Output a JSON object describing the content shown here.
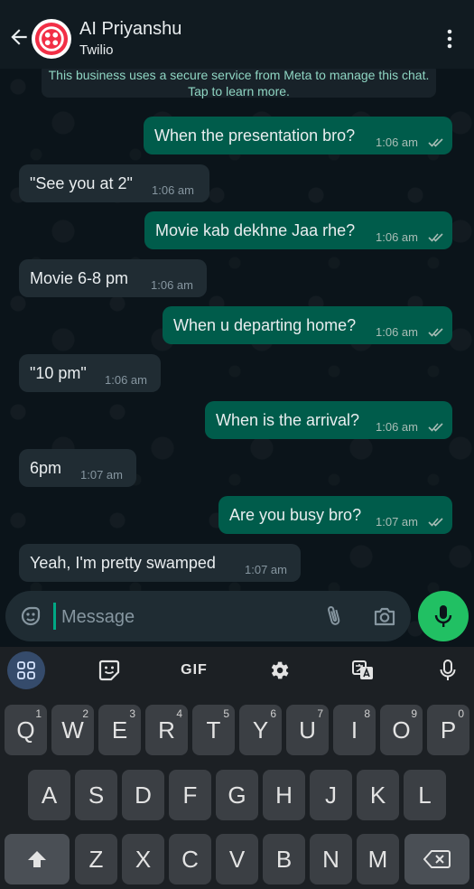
{
  "header": {
    "contact_name": "AI Priyanshu",
    "contact_subtitle": "Twilio"
  },
  "system_note": "This business uses a secure service from Meta to manage this chat. Tap to learn more.",
  "messages": [
    {
      "direction": "out",
      "text": "When the presentation bro?",
      "time": "1:06 am"
    },
    {
      "direction": "in",
      "text": "\"See you at 2\"",
      "time": "1:06 am"
    },
    {
      "direction": "out",
      "text": "Movie kab dekhne Jaa rhe?",
      "time": "1:06 am"
    },
    {
      "direction": "in",
      "text": "Movie 6-8 pm",
      "time": "1:06 am"
    },
    {
      "direction": "out",
      "text": "When u departing home?",
      "time": "1:06 am"
    },
    {
      "direction": "in",
      "text": "\"10 pm\"",
      "time": "1:06 am"
    },
    {
      "direction": "out",
      "text": "When is the arrival?",
      "time": "1:06 am"
    },
    {
      "direction": "in",
      "text": "6pm",
      "time": "1:07 am"
    },
    {
      "direction": "out",
      "text": "Are you busy bro?",
      "time": "1:07 am"
    },
    {
      "direction": "in",
      "text": "Yeah, I'm pretty swamped",
      "time": "1:07 am"
    }
  ],
  "composer": {
    "placeholder": "Message"
  },
  "keyboard": {
    "toolbar": {
      "gif_label": "GIF"
    },
    "row1": [
      {
        "label": "Q",
        "hint": "1"
      },
      {
        "label": "W",
        "hint": "2"
      },
      {
        "label": "E",
        "hint": "3"
      },
      {
        "label": "R",
        "hint": "4"
      },
      {
        "label": "T",
        "hint": "5"
      },
      {
        "label": "Y",
        "hint": "6"
      },
      {
        "label": "U",
        "hint": "7"
      },
      {
        "label": "I",
        "hint": "8"
      },
      {
        "label": "O",
        "hint": "9"
      },
      {
        "label": "P",
        "hint": "0"
      }
    ],
    "row2": [
      "A",
      "S",
      "D",
      "F",
      "G",
      "H",
      "J",
      "K",
      "L"
    ],
    "row3": [
      "Z",
      "X",
      "C",
      "V",
      "B",
      "N",
      "M"
    ]
  },
  "colors": {
    "outgoing_bubble": "#005c4b",
    "incoming_bubble": "#202c33",
    "accent_green": "#21c063",
    "read_ticks": "#a9bdb6"
  }
}
